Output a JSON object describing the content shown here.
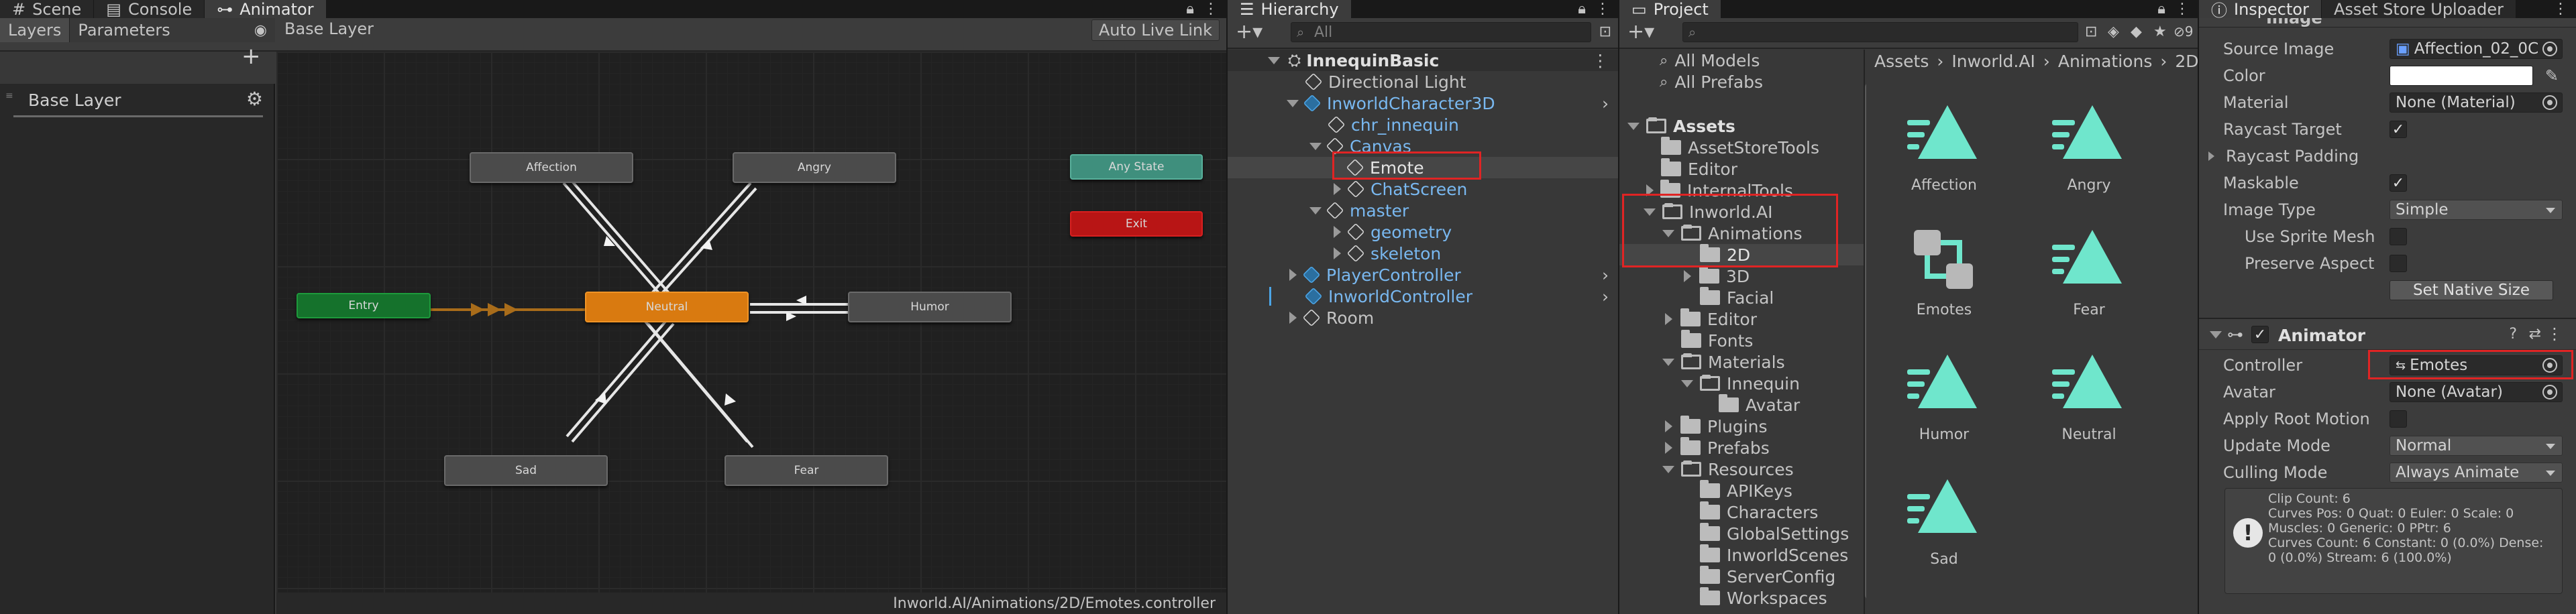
{
  "tabs_left": {
    "scene": "Scene",
    "console": "Console",
    "animator": "Animator"
  },
  "animator": {
    "subtabs": {
      "layers": "Layers",
      "parameters": "Parameters"
    },
    "breadcrumb": "Base Layer",
    "auto_live_link": "Auto Live Link",
    "layer_name": "Base Layer",
    "states": {
      "affection": "Affection",
      "angry": "Angry",
      "any_state": "Any State",
      "exit": "Exit",
      "entry": "Entry",
      "neutral": "Neutral",
      "humor": "Humor",
      "sad": "Sad",
      "fear": "Fear"
    },
    "status_path": "Inworld.AI/Animations/2D/Emotes.controller"
  },
  "hierarchy": {
    "title": "Hierarchy",
    "search_placeholder": "All",
    "items": [
      {
        "label": "InnequinBasic",
        "depth": 0,
        "icon": "unity-scene-icon"
      },
      {
        "label": "Directional Light",
        "depth": 1,
        "icon": "cube-icon"
      },
      {
        "label": "InworldCharacter3D",
        "depth": 1,
        "icon": "prefab-icon"
      },
      {
        "label": "chr_innequin",
        "depth": 2,
        "icon": "cube-icon"
      },
      {
        "label": "Canvas",
        "depth": 2,
        "icon": "cube-icon"
      },
      {
        "label": "Emote",
        "depth": 3,
        "icon": "cube-icon"
      },
      {
        "label": "ChatScreen",
        "depth": 3,
        "icon": "prefab-icon"
      },
      {
        "label": "master",
        "depth": 2,
        "icon": "cube-icon"
      },
      {
        "label": "geometry",
        "depth": 3,
        "icon": "prefab-icon"
      },
      {
        "label": "skeleton",
        "depth": 3,
        "icon": "cube-icon"
      },
      {
        "label": "PlayerController",
        "depth": 1,
        "icon": "prefab-icon"
      },
      {
        "label": "InworldController",
        "depth": 1,
        "icon": "prefab-icon"
      },
      {
        "label": "Room",
        "depth": 1,
        "icon": "cube-icon"
      }
    ]
  },
  "project": {
    "title": "Project",
    "hidden_count": "9",
    "favorites": [
      "All Models",
      "All Prefabs"
    ],
    "tree": [
      {
        "label": "Assets",
        "depth": 0
      },
      {
        "label": "AssetStoreTools",
        "depth": 1
      },
      {
        "label": "Editor",
        "depth": 1
      },
      {
        "label": "InternalTools",
        "depth": 1
      },
      {
        "label": "Inworld.AI",
        "depth": 1
      },
      {
        "label": "Animations",
        "depth": 2
      },
      {
        "label": "2D",
        "depth": 3
      },
      {
        "label": "3D",
        "depth": 3
      },
      {
        "label": "Facial",
        "depth": 3
      },
      {
        "label": "Editor",
        "depth": 2
      },
      {
        "label": "Fonts",
        "depth": 2
      },
      {
        "label": "Materials",
        "depth": 2
      },
      {
        "label": "Innequin",
        "depth": 3
      },
      {
        "label": "Avatar",
        "depth": 4
      },
      {
        "label": "Plugins",
        "depth": 2
      },
      {
        "label": "Prefabs",
        "depth": 2
      },
      {
        "label": "Resources",
        "depth": 2
      },
      {
        "label": "APIKeys",
        "depth": 3
      },
      {
        "label": "Characters",
        "depth": 3
      },
      {
        "label": "GlobalSettings",
        "depth": 3
      },
      {
        "label": "InworldScenes",
        "depth": 3
      },
      {
        "label": "ServerConfig",
        "depth": 3
      },
      {
        "label": "Workspaces",
        "depth": 3
      }
    ],
    "breadcrumb": [
      "Assets",
      "Inworld.AI",
      "Animations",
      "2D"
    ],
    "assets": [
      "Affection",
      "Angry",
      "Emotes",
      "Fear",
      "Humor",
      "Neutral",
      "Sad"
    ]
  },
  "inspector": {
    "title": "Inspector",
    "tab2": "Asset Store Uploader",
    "image_section": "Image",
    "rows": {
      "source_image_label": "Source Image",
      "source_image_value": "Affection_02_0C",
      "color_label": "Color",
      "material_label": "Material",
      "material_value": "None (Material)",
      "raycast_target_label": "Raycast Target",
      "raycast_padding_label": "Raycast Padding",
      "maskable_label": "Maskable",
      "image_type_label": "Image Type",
      "image_type_value": "Simple",
      "use_sprite_mesh_label": "Use Sprite Mesh",
      "preserve_aspect_label": "Preserve Aspect",
      "set_native_size": "Set Native Size"
    },
    "animator_section": "Animator",
    "animator_rows": {
      "controller_label": "Controller",
      "controller_value": "Emotes",
      "avatar_label": "Avatar",
      "avatar_value": "None (Avatar)",
      "apply_root_motion_label": "Apply Root Motion",
      "update_mode_label": "Update Mode",
      "update_mode_value": "Normal",
      "culling_mode_label": "Culling Mode",
      "culling_mode_value": "Always Animate"
    },
    "info_lines": [
      "Clip Count: 6",
      "Curves Pos: 0 Quat: 0 Euler: 0 Scale: 0",
      "Muscles: 0 Generic: 0 PPtr: 6",
      "Curves Count: 6 Constant: 0 (0.0%) Dense:",
      "0 (0.0%) Stream: 6 (100.0%)"
    ]
  }
}
